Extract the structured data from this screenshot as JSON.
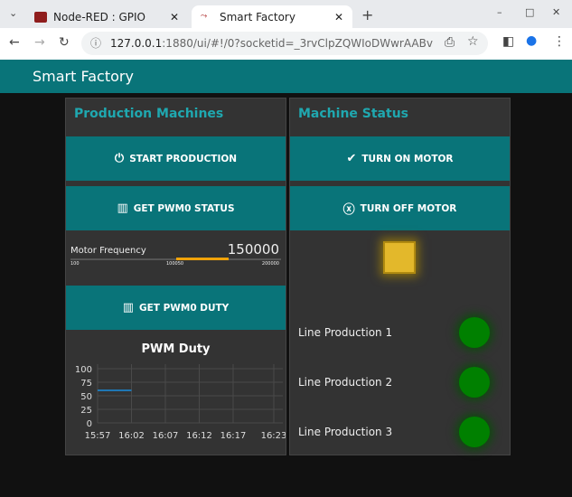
{
  "browser": {
    "tabs": [
      {
        "title": "Node-RED : GPIO"
      },
      {
        "title": "Smart Factory"
      }
    ],
    "url_host": "127.0.0.1",
    "url_rest": ":1880/ui/#!/0?socketid=_3rvClpZQWIoDWwrAABv"
  },
  "app": {
    "title": "Smart Factory",
    "accent": "#097479"
  },
  "left": {
    "title": "Production Machines",
    "start": "START PRODUCTION",
    "pwm_status": "GET PWM0 STATUS",
    "slider": {
      "label": "Motor Frequency",
      "value": "150000",
      "min": "100",
      "mid": "100050",
      "max": "200000",
      "fill_from": 100050,
      "fill_to": 150000,
      "color": "#f0a30a"
    },
    "pwm_duty": "GET PWM0 DUTY"
  },
  "right": {
    "title": "Machine Status",
    "on": "TURN ON MOTOR",
    "off": "TURN OFF MOTOR",
    "indicator_color": "#e3b82b",
    "lines": [
      {
        "label": "Line Production 1",
        "color": "#008000"
      },
      {
        "label": "Line Production 2",
        "color": "#008000"
      },
      {
        "label": "Line Production 3",
        "color": "#008000"
      }
    ]
  },
  "chart_data": {
    "type": "line",
    "title": "PWM Duty",
    "y_ticks": [
      "100",
      "75",
      "50",
      "25",
      "0"
    ],
    "ylim": [
      0,
      100
    ],
    "x_ticks": [
      "15:57",
      "16:02",
      "16:07",
      "16:12",
      "16:17",
      "16:23"
    ],
    "series": [
      {
        "x": [
          "15:57",
          "16:02"
        ],
        "values": [
          60,
          60
        ],
        "color": "#1f77b4"
      }
    ],
    "grid": true
  }
}
